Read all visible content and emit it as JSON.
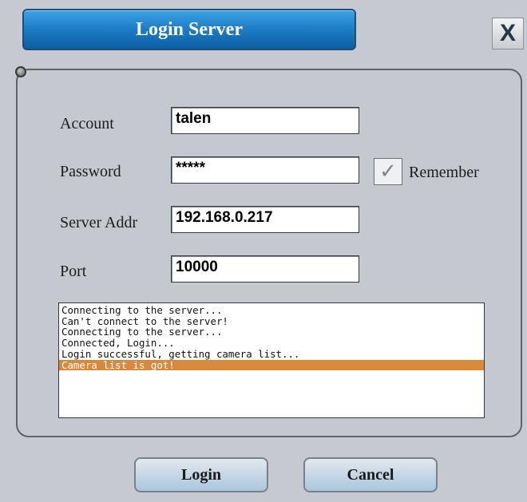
{
  "window": {
    "title": "Login Server",
    "close_label": "X"
  },
  "form": {
    "account_label": "Account",
    "account_value": "talen",
    "password_label": "Password",
    "password_value": "*****",
    "remember_label": "Remember",
    "remember_checked": true,
    "remember_check_glyph": "✓",
    "server_label": "Server Addr",
    "server_value": "192.168.0.217",
    "port_label": "Port",
    "port_value": "10000"
  },
  "log": {
    "lines": [
      "Connecting to the server...",
      "Can't connect to the server!",
      "Connecting to the server...",
      "Connected, Login...",
      "Login successful, getting camera list...",
      "Camera list is got!"
    ],
    "selected_index": 5
  },
  "buttons": {
    "login_label": "Login",
    "cancel_label": "Cancel"
  },
  "colors": {
    "title_bar": "#1e7fc8",
    "selection": "#d88a3c",
    "background": "#c6cad0"
  },
  "icons": {
    "close": "close-icon",
    "status": "status-led-icon",
    "check": "check-icon"
  }
}
